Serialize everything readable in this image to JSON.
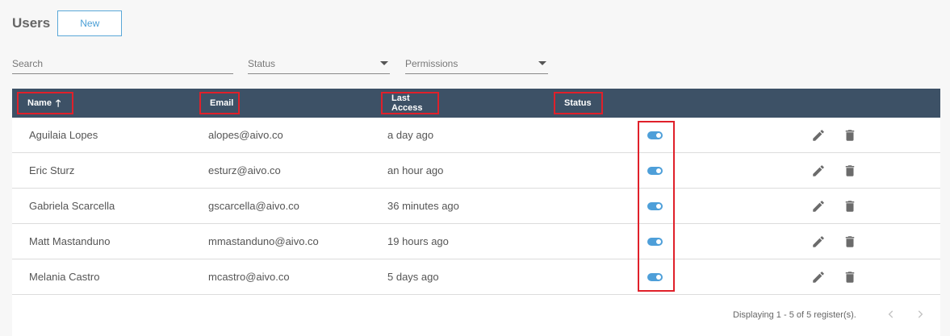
{
  "header": {
    "title": "Users",
    "new_label": "New"
  },
  "filters": {
    "search_placeholder": "Search",
    "status_label": "Status",
    "permissions_label": "Permissions"
  },
  "table": {
    "columns": [
      {
        "label": "Name",
        "sort": "ascending"
      },
      {
        "label": "Email"
      },
      {
        "label": "Last Access"
      },
      {
        "label": "Status"
      }
    ],
    "rows": [
      {
        "name": "Aguilaia Lopes",
        "email": "alopes@aivo.co",
        "last_access": "a day ago",
        "status_on": true
      },
      {
        "name": "Eric Sturz",
        "email": "esturz@aivo.co",
        "last_access": "an hour ago",
        "status_on": true
      },
      {
        "name": "Gabriela Scarcella",
        "email": "gscarcella@aivo.co",
        "last_access": "36 minutes ago",
        "status_on": true
      },
      {
        "name": "Matt Mastanduno",
        "email": "mmastanduno@aivo.co",
        "last_access": "19 hours ago",
        "status_on": true
      },
      {
        "name": "Melania Castro",
        "email": "mcastro@aivo.co",
        "last_access": "5 days ago",
        "status_on": true
      }
    ]
  },
  "pagination": {
    "text": "Displaying 1 - 5 of 5 register(s)."
  },
  "colors": {
    "header_bg": "#3d5166",
    "accent": "#4e9fd9",
    "highlight": "#e0202a",
    "icon": "#6b6b6b"
  },
  "icons": {
    "sort": "arrow-up-icon",
    "edit": "pencil-icon",
    "delete": "trash-icon",
    "prev": "chevron-left-icon",
    "next": "chevron-right-icon"
  }
}
